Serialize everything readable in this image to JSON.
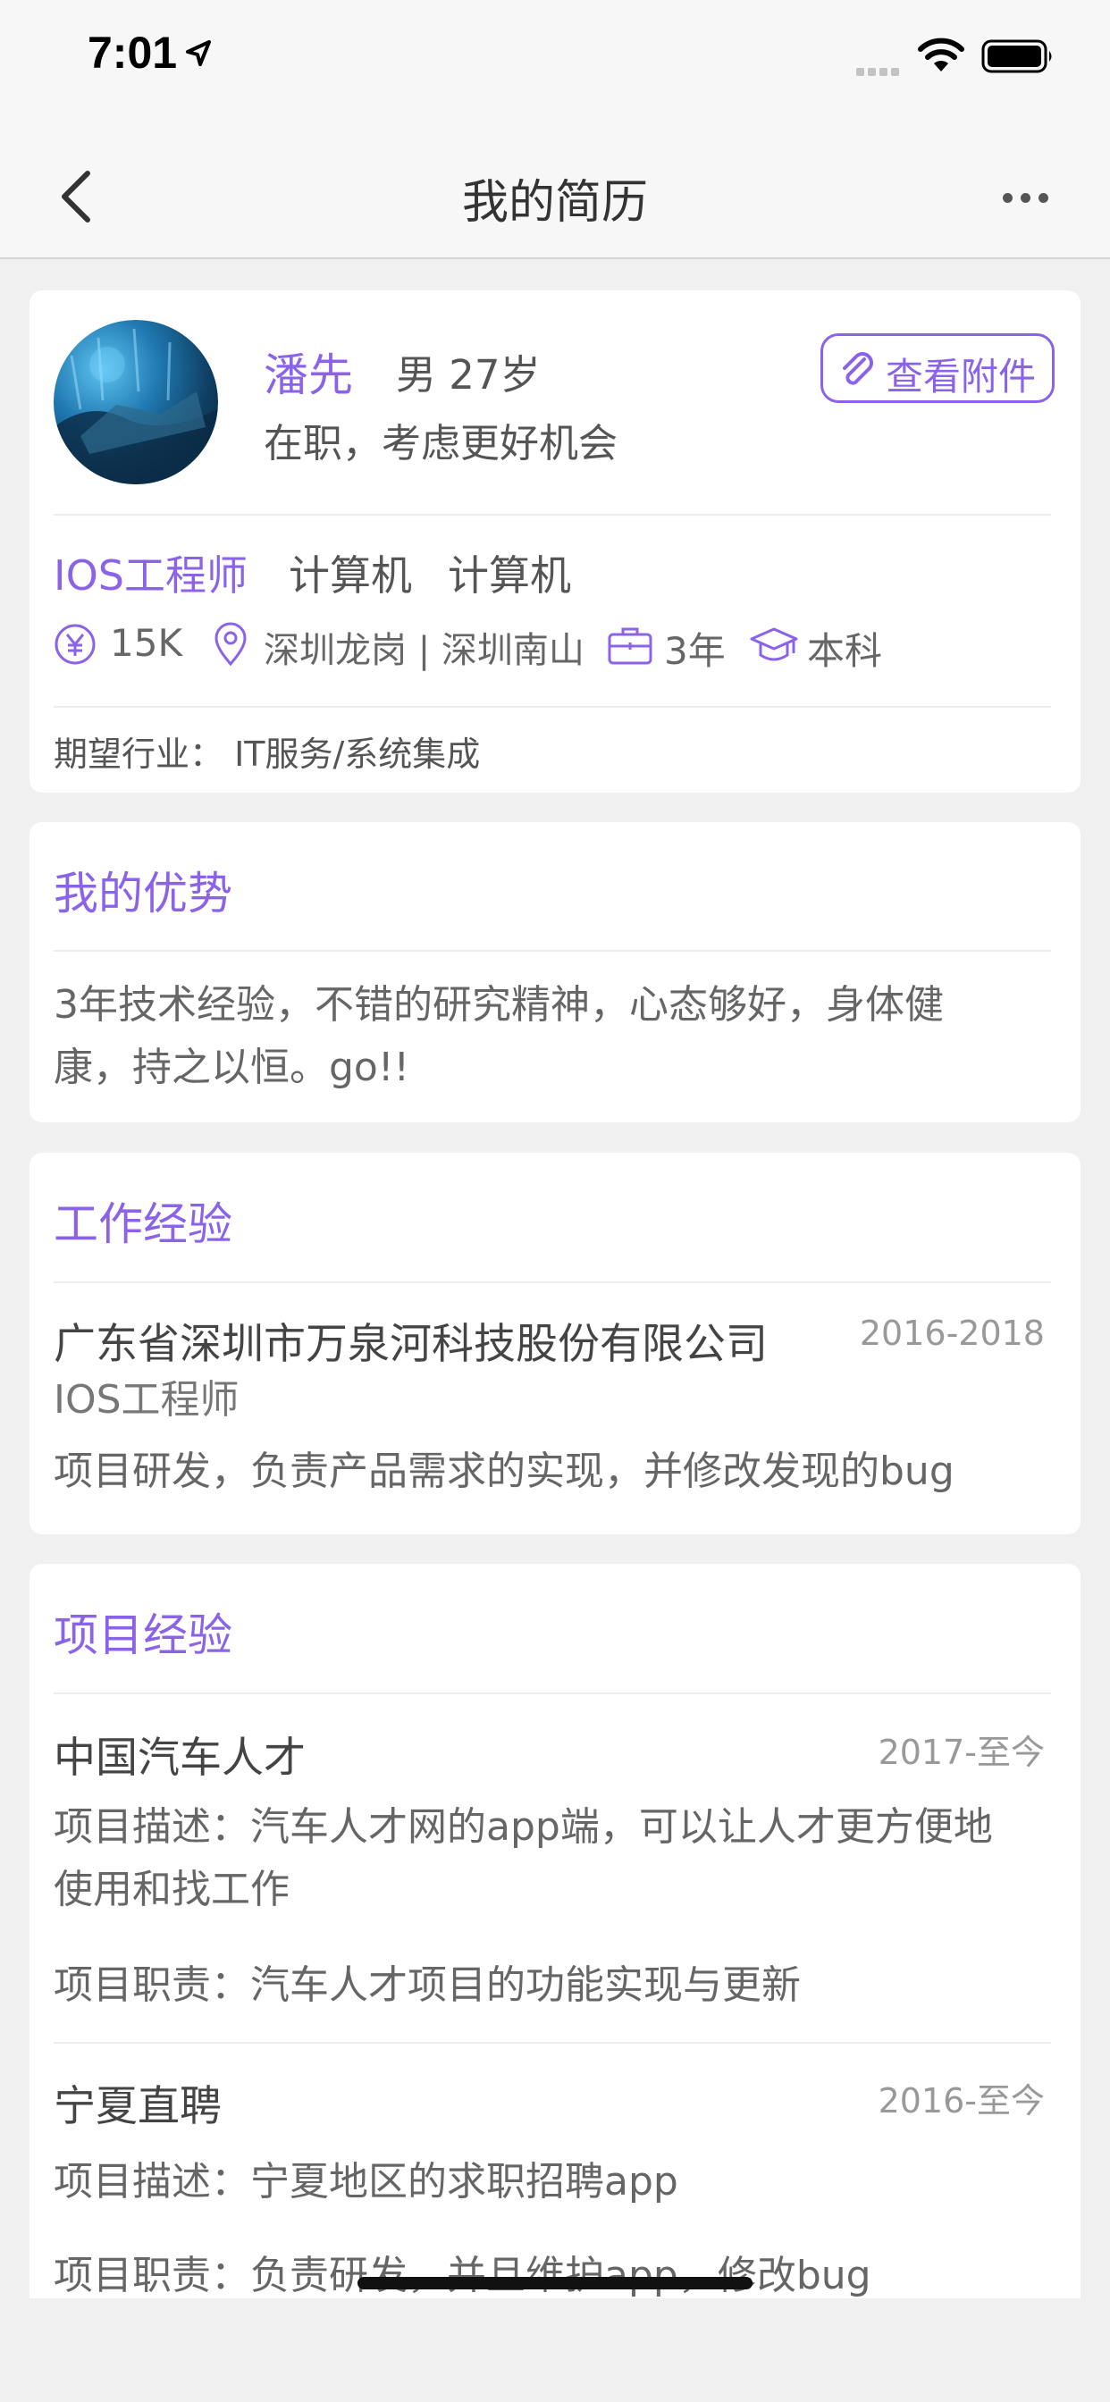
{
  "status_bar": {
    "time": "7:01"
  },
  "nav": {
    "title": "我的简历"
  },
  "profile": {
    "name": "潘先",
    "gender_age": "男 27岁",
    "status": "在职，考虑更好机会",
    "attachment_button": "查看附件",
    "job_title": "IOS工程师",
    "major_1": "计算机",
    "major_2": "计算机",
    "salary": "15K",
    "location": "深圳龙岗 | 深圳南山",
    "experience": "3年",
    "education": "本科",
    "industry": "期望行业：  IT服务/系统集成"
  },
  "advantage": {
    "title": "我的优势",
    "lines": [
      "3年技术经验，不错的研究精神，心态够好，身体健",
      "康，持之以恒。go!!"
    ]
  },
  "work": {
    "title": "工作经验",
    "items": [
      {
        "company": "广东省深圳市万泉河科技股份有限公司",
        "period": "2016-2018",
        "position": "IOS工程师",
        "description": "项目研发，负责产品需求的实现，并修改发现的bug"
      }
    ]
  },
  "projects": {
    "title": "项目经验",
    "items": [
      {
        "name": "中国汽车人才",
        "period": "2017-至今",
        "desc_lines": [
          "项目描述：汽车人才网的app端，可以让人才更方便地",
          "使用和找工作"
        ],
        "duty": "项目职责：汽车人才项目的功能实现与更新"
      },
      {
        "name": "宁夏直聘",
        "period": "2016-至今",
        "desc_lines": [
          "项目描述：宁夏地区的求职招聘app"
        ],
        "duty": "项目职责：负责研发，并且维护app，修改bug"
      }
    ]
  },
  "colors": {
    "accent": "#8b63e8",
    "background": "#f0f0f0",
    "text": "#555555"
  }
}
